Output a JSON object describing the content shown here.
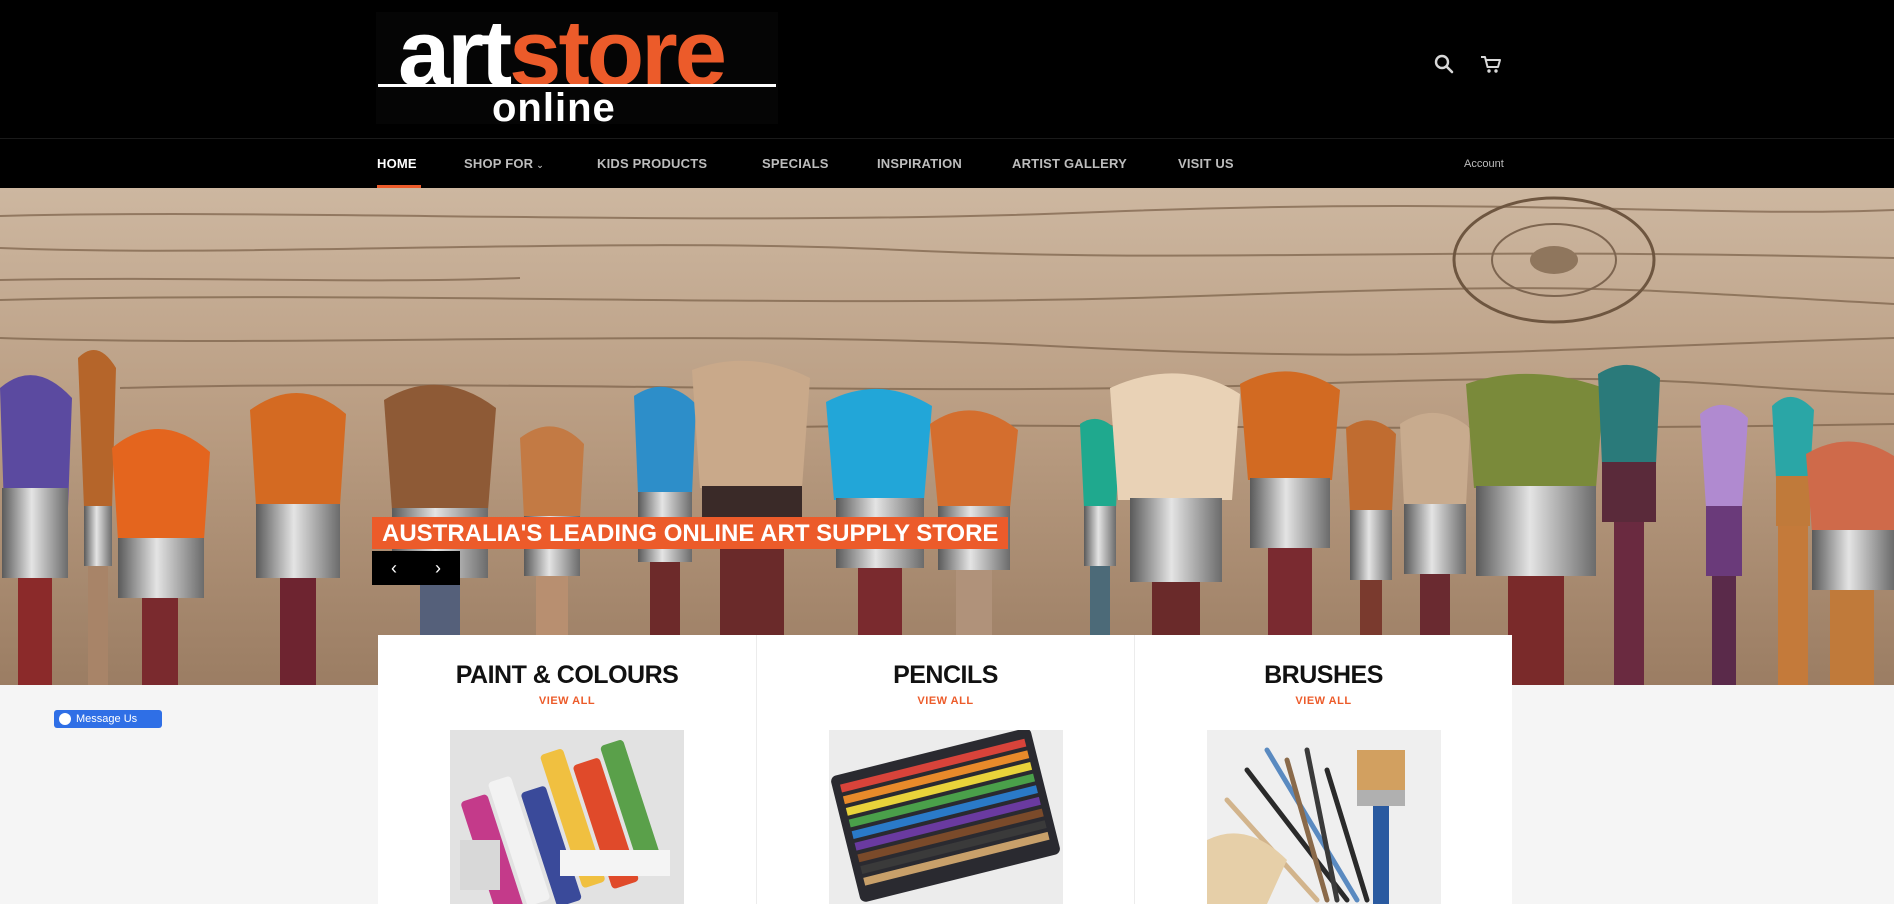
{
  "brand": {
    "logo_part1": "art",
    "logo_part2": "store",
    "logo_line2": "online",
    "accent_color": "#ec5b2a"
  },
  "header": {
    "search_icon": "search-icon",
    "cart_icon": "cart-icon"
  },
  "nav": {
    "items": [
      {
        "label": "HOME",
        "active": true
      },
      {
        "label": "SHOP FOR",
        "has_dropdown": true
      },
      {
        "label": "KIDS PRODUCTS"
      },
      {
        "label": "SPECIALS"
      },
      {
        "label": "INSPIRATION"
      },
      {
        "label": "ARTIST GALLERY"
      },
      {
        "label": "VISIT US"
      }
    ],
    "account_label": "Account"
  },
  "hero": {
    "caption": "AUSTRALIA'S LEADING ONLINE ART SUPPLY STORE",
    "prev_label": "‹",
    "next_label": "›"
  },
  "messenger": {
    "label": "Message Us"
  },
  "categories": [
    {
      "title": "PAINT & COLOURS",
      "link": "VIEW ALL"
    },
    {
      "title": "PENCILS",
      "link": "VIEW ALL"
    },
    {
      "title": "BRUSHES",
      "link": "VIEW ALL"
    }
  ]
}
